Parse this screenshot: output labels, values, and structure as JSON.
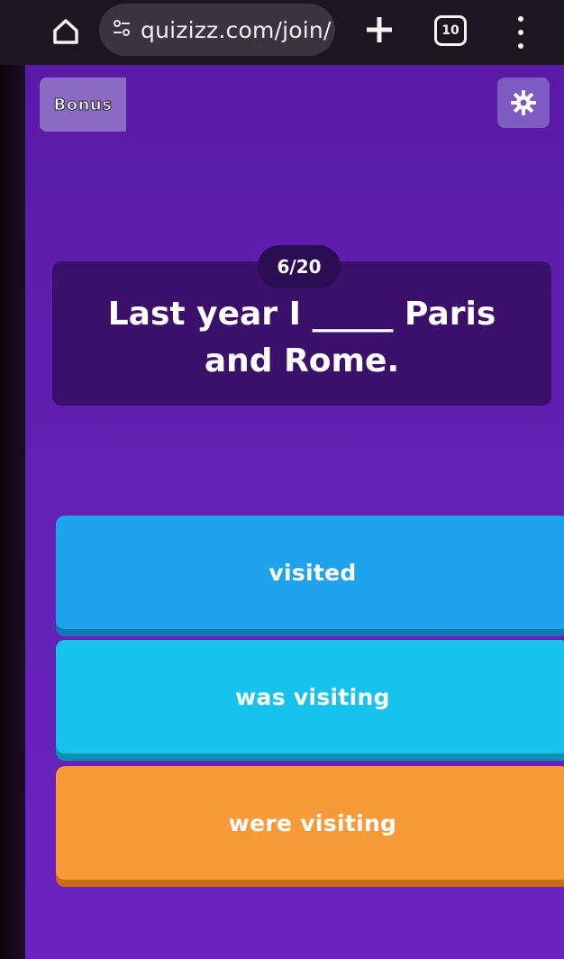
{
  "browser": {
    "url": "quizizz.com/join/",
    "tab_count": "10"
  },
  "game": {
    "bonus_label": "Bonus",
    "counter": "6/20",
    "question": "Last year I _____ Paris and Rome.",
    "options": [
      {
        "label": "visited",
        "color": "#1ea3ec"
      },
      {
        "label": "was visiting",
        "color": "#17c3ec"
      },
      {
        "label": "were visiting",
        "color": "#f79a3a"
      }
    ],
    "background_color": "#6220b4"
  },
  "icons": {
    "home": "home-icon",
    "site_settings": "tune-icon",
    "new_tab": "plus-icon",
    "tabs": "tabs-icon",
    "menu": "more-vert-icon",
    "settings": "gear-icon"
  }
}
